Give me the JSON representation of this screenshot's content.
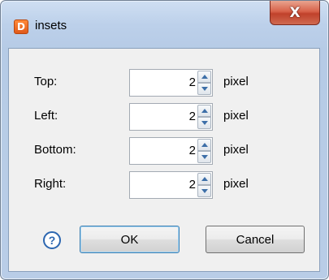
{
  "window": {
    "title": "insets",
    "app_icon_glyph": "D",
    "close_glyph": "X"
  },
  "fields": [
    {
      "label": "Top:",
      "value": "2",
      "unit": "pixel"
    },
    {
      "label": "Left:",
      "value": "2",
      "unit": "pixel"
    },
    {
      "label": "Bottom:",
      "value": "2",
      "unit": "pixel"
    },
    {
      "label": "Right:",
      "value": "2",
      "unit": "pixel"
    }
  ],
  "buttons": {
    "help_glyph": "?",
    "ok_label": "OK",
    "cancel_label": "Cancel"
  },
  "colors": {
    "title_bar": "#bcd0ea",
    "close_button": "#c7432e",
    "spinner_arrow": "#3d6fa8",
    "help_icon": "#2c66b0",
    "ok_border": "#3c7fb1"
  }
}
